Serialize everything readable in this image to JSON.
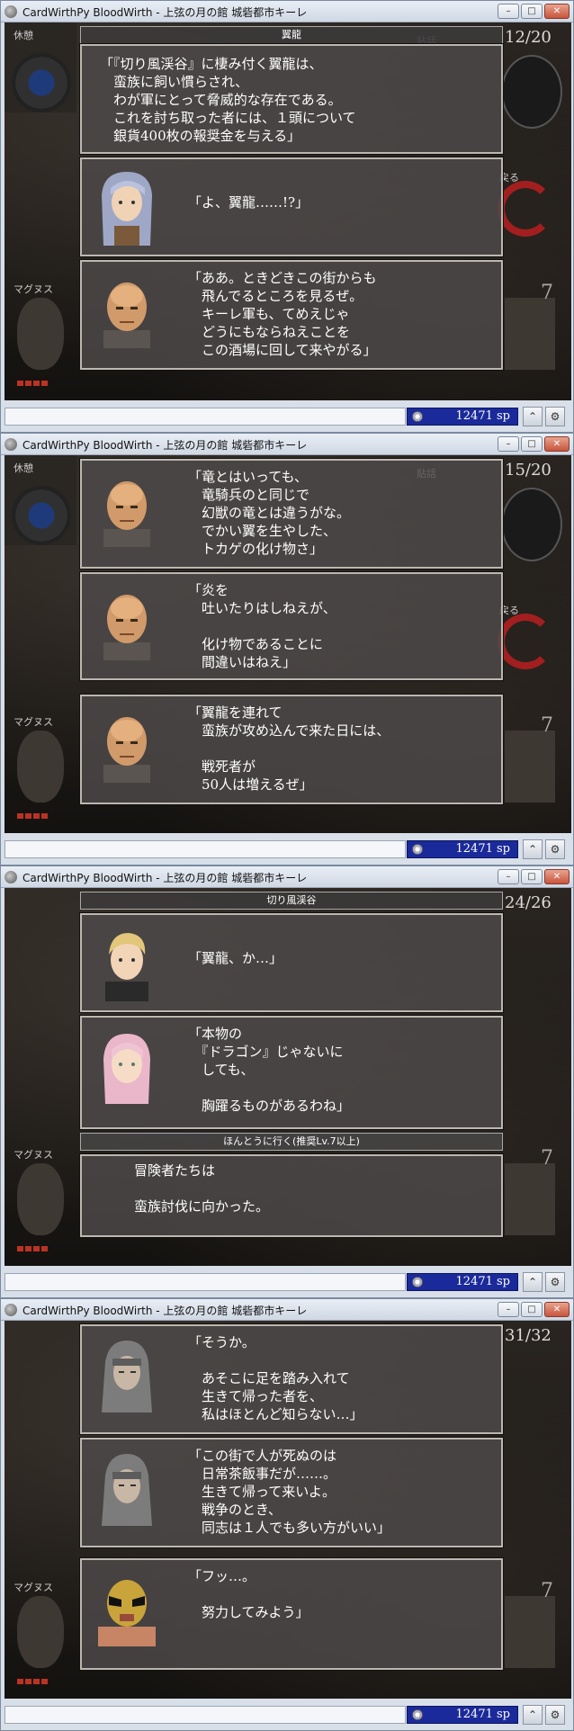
{
  "app_title": "CardWirthPy BloodWirth - 上弦の月の館 城砦都市キーレ",
  "window_buttons": {
    "minimize": "–",
    "maximize": "□",
    "close": "✕"
  },
  "money": "12471 sp",
  "status_icons": [
    "coin-icon",
    "map-icon",
    "gear-icon"
  ],
  "screens": [
    {
      "counter": "12/20",
      "header": "翼龍",
      "side_labels": {
        "left_top": "休憩",
        "left_bottom": "マグヌス",
        "right_top": "貼話",
        "right_mid": "戻る"
      },
      "dialogs": [
        {
          "speaker": "narration",
          "text": "「『切り風渓谷』に棲み付く翼龍は、\n　蛮族に飼い慣らされ、\n　わが軍にとって脅威的な存在である。\n　これを討ち取った者には、１頭について\n　銀貨400枚の報奨金を与える」"
        },
        {
          "speaker": "silver-haired-woman",
          "text": "「よ、翼龍……!?」"
        },
        {
          "speaker": "bald-man",
          "text": "「ああ。ときどきこの街からも\n　飛んでるところを見るぜ。\n　キーレ軍も、てめえじゃ\n　どうにもならねえことを\n　この酒場に回して来やがる」"
        }
      ]
    },
    {
      "counter": "15/20",
      "side_labels": {
        "left_top": "休憩",
        "left_bottom": "マグヌス",
        "right_top": "貼話",
        "right_mid": "戻る"
      },
      "dialogs": [
        {
          "speaker": "bald-man",
          "text": "「竜とはいっても、\n　竜騎兵のと同じで\n　幻獣の竜とは違うがな。\n　でかい翼を生やした、\n　トカゲの化け物さ」"
        },
        {
          "speaker": "bald-man",
          "text": "「炎を\n　吐いたりはしねえが、\n\n　化け物であることに\n　間違いはねえ」"
        },
        {
          "speaker": "bald-man",
          "text": "「翼龍を連れて\n　蛮族が攻め込んで来た日には、\n\n　戦死者が\n　50人は増えるぜ」"
        }
      ]
    },
    {
      "counter": "24/26",
      "header": "切り風渓谷",
      "choice": "ほんとうに行く(推奨Lv.7以上)",
      "side_labels": {
        "left_bottom": "マグヌス"
      },
      "dialogs": [
        {
          "speaker": "blonde-youth",
          "text": "「翼龍、か…」"
        },
        {
          "speaker": "pink-haired-woman",
          "text": "「本物の\n　『ドラゴン』じゃないに\n　しても、\n\n　胸躍るものがあるわね」"
        },
        {
          "speaker": "narration",
          "text": "冒険者たちは\n\n蛮族討伐に向かった。"
        }
      ]
    },
    {
      "counter": "31/32",
      "side_labels": {
        "left_bottom": "マグヌス"
      },
      "dialogs": [
        {
          "speaker": "hooded-man",
          "text": "「そうか。\n\n　あそこに足を踏み入れて\n　生きて帰った者を、\n　私はほとんど知らない…」"
        },
        {
          "speaker": "hooded-man",
          "text": "「この街で人が死ぬのは\n　日常茶飯事だが……。\n　生きて帰って来いよ。\n　戦争のとき、\n　同志は１人でも多い方がいい」"
        },
        {
          "speaker": "masked-wrestler",
          "text": "「フッ…。\n\n　努力してみよう」"
        }
      ]
    }
  ],
  "bg": {
    "hint_text": "冒険者たちは",
    "hint_text2": "キーレ"
  }
}
